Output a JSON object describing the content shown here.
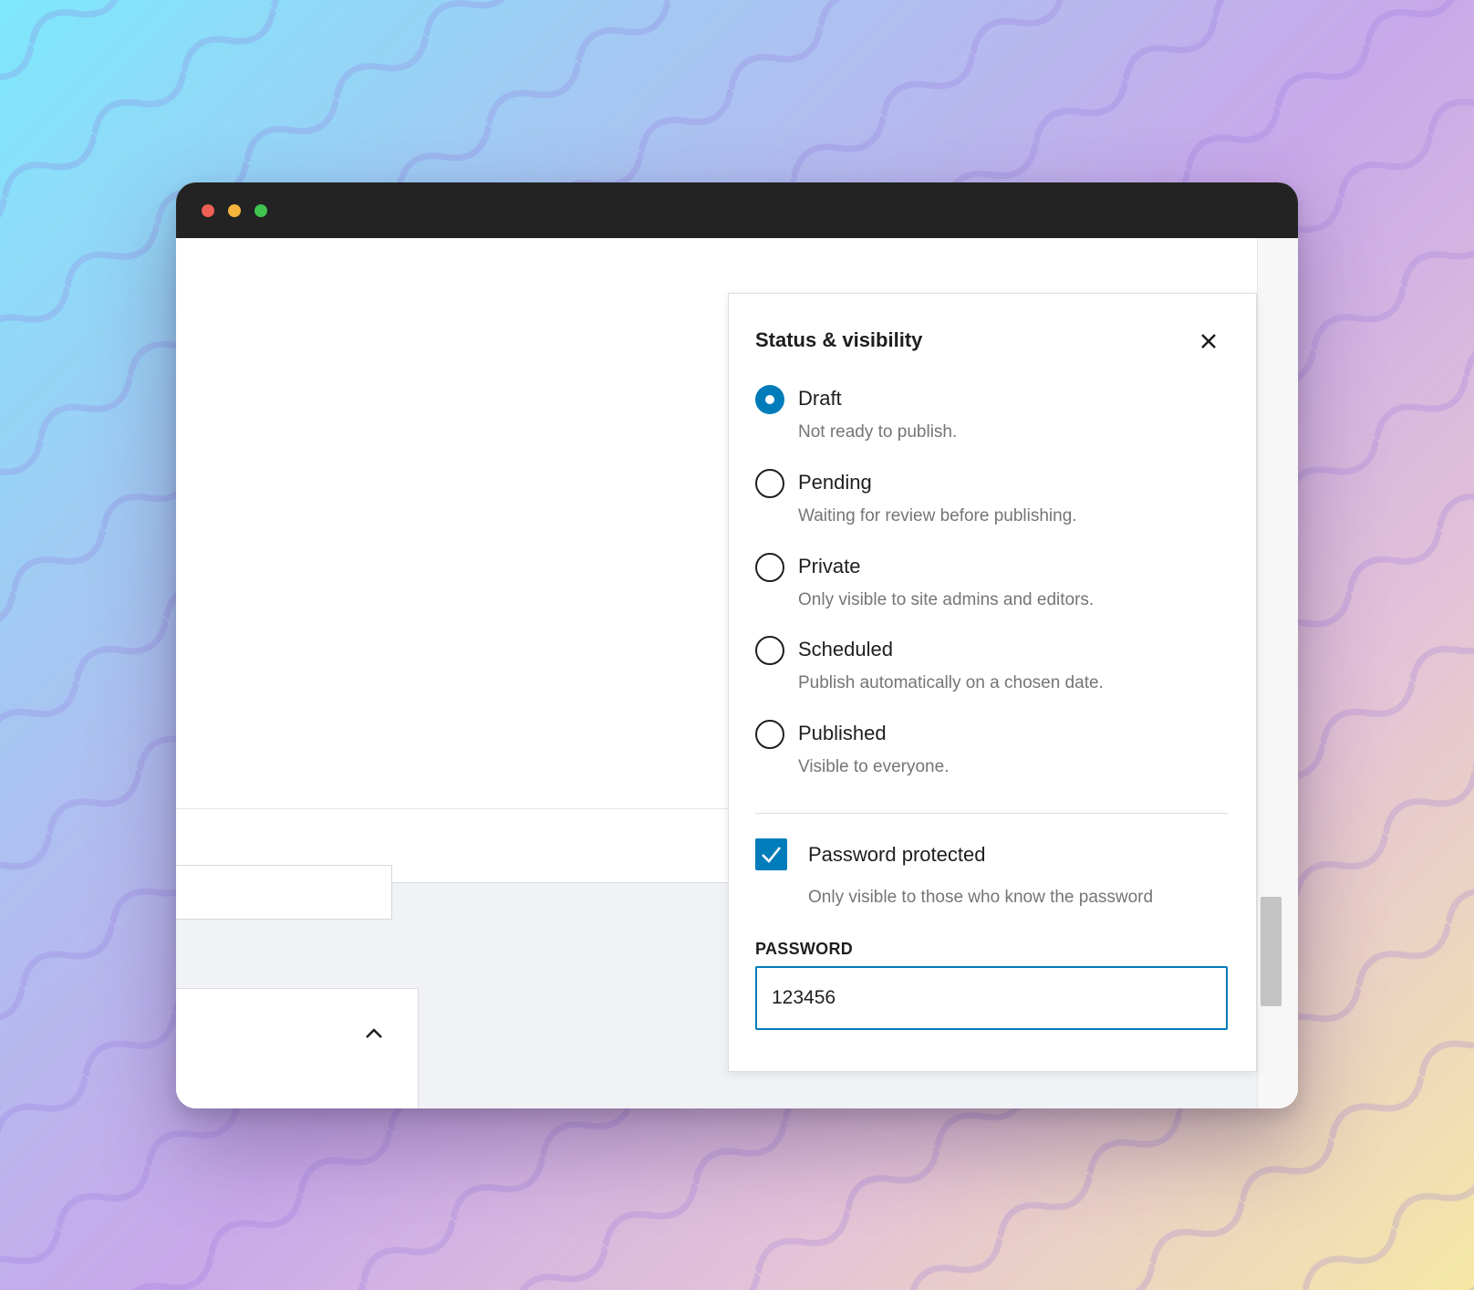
{
  "window": {
    "controls": [
      "close",
      "minimize",
      "maximize"
    ]
  },
  "popover": {
    "title": "Status & visibility",
    "close_icon": "close-icon",
    "options": [
      {
        "label": "Draft",
        "description": "Not ready to publish.",
        "checked": true
      },
      {
        "label": "Pending",
        "description": "Waiting for review before publishing.",
        "checked": false
      },
      {
        "label": "Private",
        "description": "Only visible to site admins and editors.",
        "checked": false
      },
      {
        "label": "Scheduled",
        "description": "Publish automatically on a chosen date.",
        "checked": false
      },
      {
        "label": "Published",
        "description": "Visible to everyone.",
        "checked": false
      }
    ],
    "password_protected": {
      "label": "Password protected",
      "description": "Only visible to those who know the password",
      "checked": true
    },
    "password": {
      "label": "PASSWORD",
      "value": "123456"
    }
  },
  "colors": {
    "accent": "#007cba",
    "text": "#1e1e1e",
    "muted": "#757575"
  }
}
